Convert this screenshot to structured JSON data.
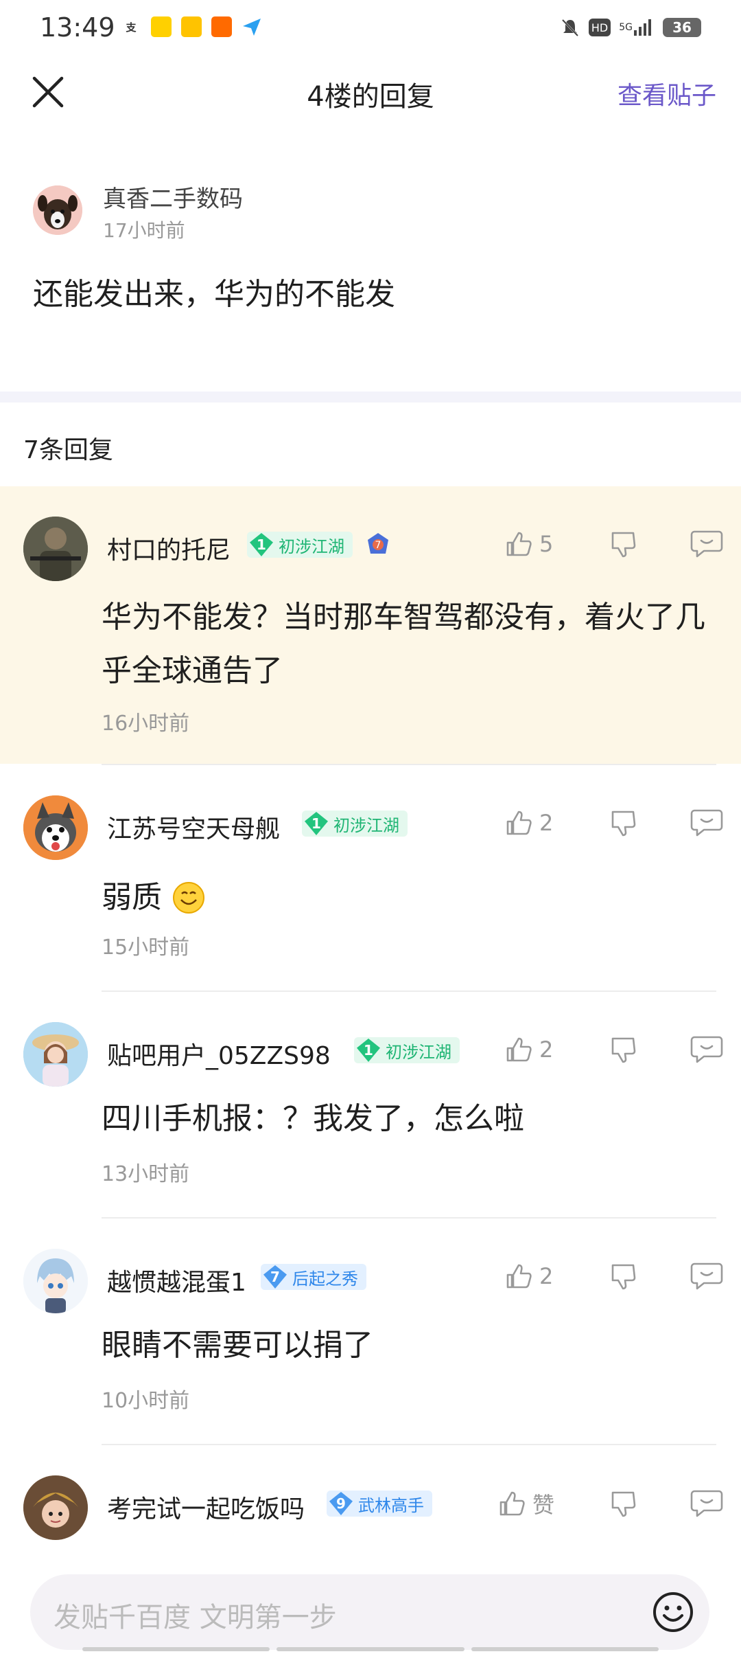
{
  "status_bar": {
    "time": "13:49",
    "battery": "36",
    "network": "5G",
    "hd": "HD",
    "app_icons": [
      "alipay-icon",
      "meituan-waimai-icon",
      "meituan-icon",
      "taobao-flash-icon",
      "share-arrow-icon"
    ]
  },
  "header": {
    "title": "4楼的回复",
    "view_post": "查看贴子"
  },
  "op": {
    "name": "真香二手数码",
    "time": "17小时前",
    "text": "还能发出来，华为的不能发"
  },
  "reply_count": "7条回复",
  "replies": [
    {
      "name": "村口的托尼",
      "level": "1",
      "title": "初涉江湖",
      "likes": "5",
      "text": "华为不能发？当时那车智驾都没有，着火了几乎全球通告了",
      "time": "16小时前"
    },
    {
      "name": "江苏号空天母舰",
      "level": "1",
      "title": "初涉江湖",
      "likes": "2",
      "text": "弱质",
      "time": "15小时前"
    },
    {
      "name": "贴吧用户_05ZZS98",
      "level": "1",
      "title": "初涉江湖",
      "likes": "2",
      "text": "四川手机报：？我发了，怎么啦",
      "time": "13小时前"
    },
    {
      "name": "越惯越混蛋1",
      "level": "7",
      "title": "后起之秀",
      "likes": "2",
      "text": "眼睛不需要可以捐了",
      "time": "10小时前"
    },
    {
      "name": "考完试一起吃饭吗",
      "level": "9",
      "title": "武林高手",
      "likes": "赞"
    }
  ],
  "input": {
    "placeholder": "发贴千百度 文明第一步"
  },
  "colors": {
    "accent": "#6b58c9",
    "highlight_bg": "#fdf7e7",
    "badge_green": "#22c47e",
    "badge_blue": "#4a9af0"
  }
}
